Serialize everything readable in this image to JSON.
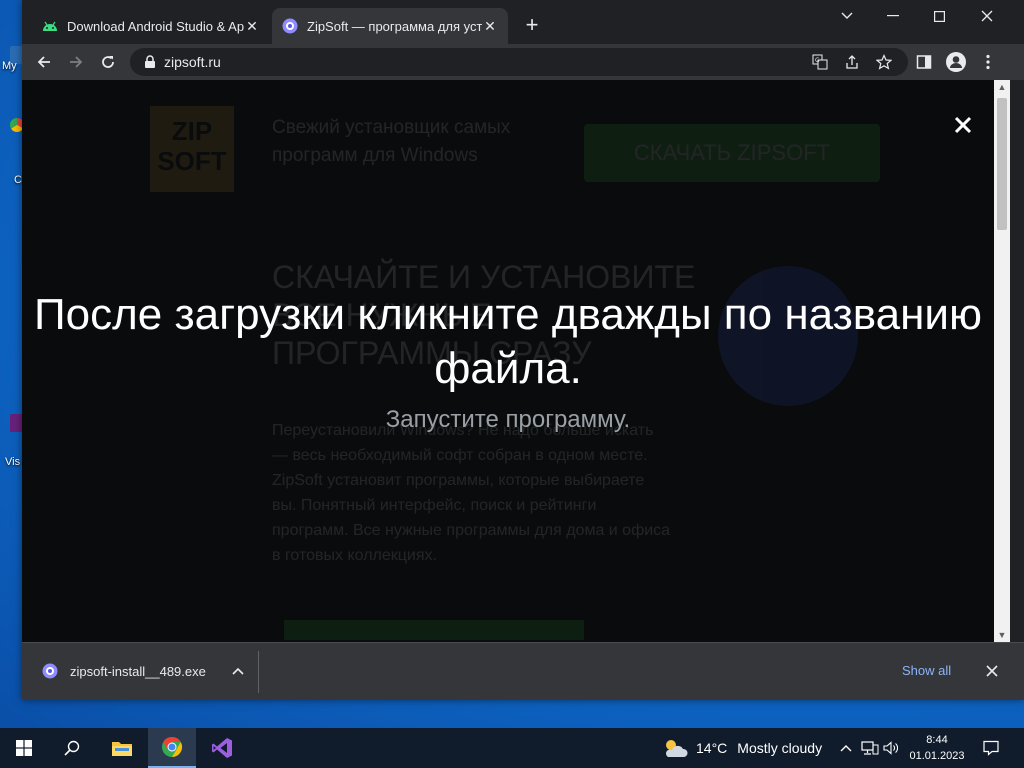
{
  "desktop": {
    "icons": [
      {
        "label": "My"
      },
      {
        "label": "C"
      },
      {
        "label": "Vis"
      }
    ]
  },
  "browser": {
    "tabs": [
      {
        "title": "Download Android Studio & App Tools - Android Developers",
        "icon": "android-icon",
        "active": false
      },
      {
        "title": "ZipSoft — программа для установки программ",
        "icon": "zipsoft-icon",
        "active": true
      }
    ],
    "url": "zipsoft.ru"
  },
  "page": {
    "background": {
      "logo": "ZIP SOFT",
      "tagline": "Свежий установщик самых программ для Windows",
      "download_button": "СКАЧАТЬ ZIPSOFT",
      "headline": "СКАЧАЙТЕ И УСТАНОВИТЕ ВСЕ НУЖНЫЕ ПРОГРАММЫ СРАЗУ",
      "body": "Переустановили Windows? Не надо больше искать — весь необходимый софт собран в одном месте. ZipSoft установит программы, которые выбираете вы. Понятный интерфейс, поиск и рейтинги программ. Все нужные программы для дома и офиса в готовых коллекциях."
    },
    "overlay": {
      "title": "После загрузки кликните дважды по названию файла.",
      "subtitle": "Запустите программу."
    }
  },
  "downloads": {
    "file": "zipsoft-install__489.exe",
    "show_all": "Show all"
  },
  "taskbar": {
    "weather_temp": "14°C",
    "weather_text": "Mostly cloudy",
    "time": "8:44",
    "date": "01.01.2023"
  },
  "colors": {
    "accent_link": "#8ab4f8",
    "taskbar_bg": "#101c2c",
    "chrome_dark": "#202124",
    "chrome_mid": "#35363a"
  }
}
